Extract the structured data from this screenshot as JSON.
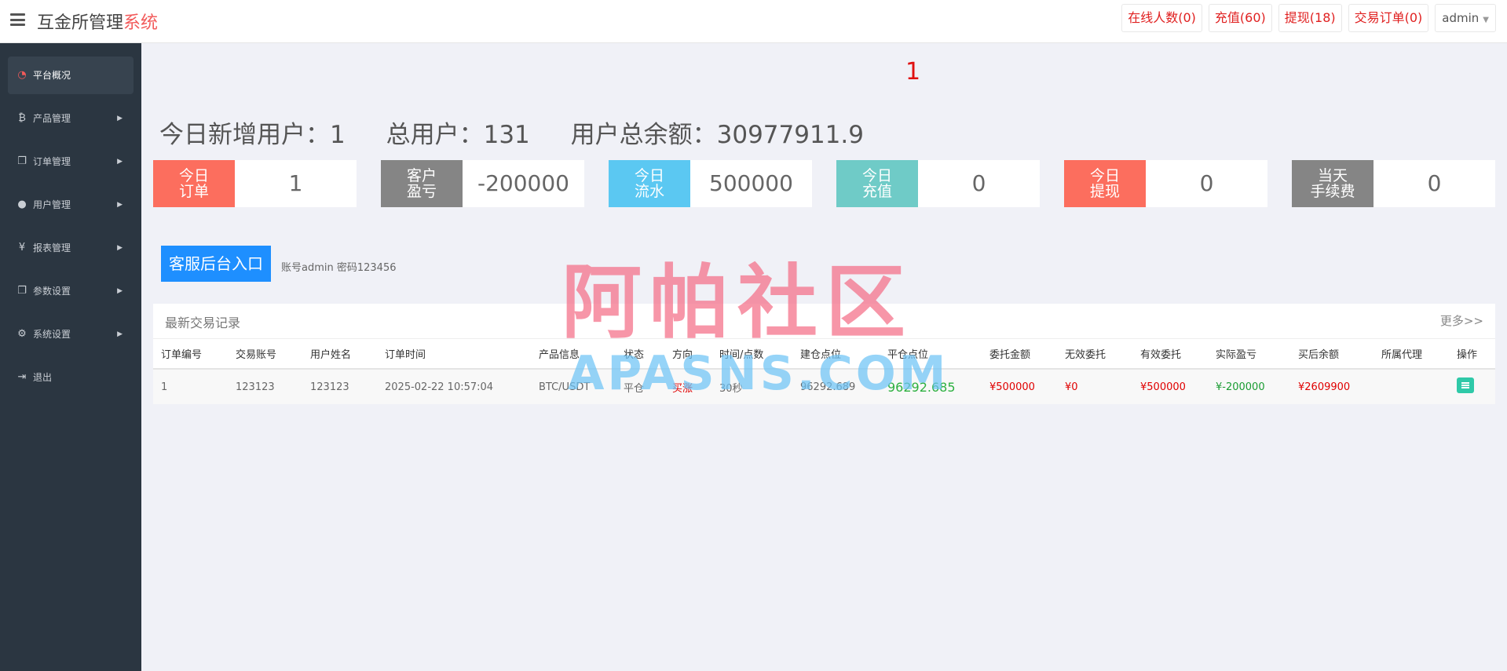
{
  "header": {
    "brand_main": "互金所管理",
    "brand_accent": "系统",
    "online": "在线人数(0)",
    "recharge": "充值(60)",
    "withdraw": "提现(18)",
    "trade_orders": "交易订单(0)",
    "user": "admin"
  },
  "sidebar": {
    "items": [
      {
        "label": "平台概况",
        "icon": "dashboard-icon",
        "glyph": "◔"
      },
      {
        "label": "产品管理",
        "icon": "bitcoin-icon",
        "glyph": "₿"
      },
      {
        "label": "订单管理",
        "icon": "copy-icon",
        "glyph": "❐"
      },
      {
        "label": "用户管理",
        "icon": "user-icon",
        "glyph": "●"
      },
      {
        "label": "报表管理",
        "icon": "yen-icon",
        "glyph": "¥"
      },
      {
        "label": "参数设置",
        "icon": "copy-icon",
        "glyph": "❐"
      },
      {
        "label": "系统设置",
        "icon": "gears-icon",
        "glyph": "⚙"
      },
      {
        "label": "退出",
        "icon": "sign-out-icon",
        "glyph": "⇥"
      }
    ]
  },
  "main": {
    "alert_number": "1",
    "summary": {
      "new_users": "今日新增用户：1",
      "total_users": "总用户：131",
      "total_balance": "用户总余额：30977911.9"
    },
    "cards": [
      {
        "label": "今日\n订单",
        "value": "1",
        "color": "#fc6e5e"
      },
      {
        "label": "客户\n盈亏",
        "value": "-200000",
        "color": "#858585"
      },
      {
        "label": "今日\n流水",
        "value": "500000",
        "color": "#5bc8f2"
      },
      {
        "label": "今日\n充值",
        "value": "0",
        "color": "#6fcbc7"
      },
      {
        "label": "今日\n提现",
        "value": "0",
        "color": "#fc6e5e"
      },
      {
        "label": "当天\n手续费",
        "value": "0",
        "color": "#858585"
      }
    ],
    "cs_button": "客服后台入口",
    "cs_note": "账号admin 密码123456"
  },
  "panel": {
    "title": "最新交易记录",
    "more": "更多>>",
    "columns": [
      "订单编号",
      "交易账号",
      "用户姓名",
      "订单时间",
      "产品信息",
      "状态",
      "方向",
      "时间/点数",
      "建仓点位",
      "平仓点位",
      "委托金额",
      "无效委托",
      "有效委托",
      "实际盈亏",
      "买后余额",
      "所属代理",
      "操作"
    ],
    "rows": [
      {
        "order_no": "1",
        "account": "123123",
        "name": "123123",
        "time": "2025-02-22 10:57:04",
        "product": "BTC/USDT",
        "status": "平仓",
        "direction": "买涨",
        "duration": "30秒",
        "open_price": "96292.689",
        "close_price": "96292.685",
        "amount": "¥500000",
        "invalid": "¥0",
        "valid": "¥500000",
        "profit": "¥-200000",
        "balance": "¥2609900",
        "agent": ""
      }
    ]
  },
  "watermark": {
    "cn": "阿帕社区",
    "en": "APASNS.COM"
  }
}
